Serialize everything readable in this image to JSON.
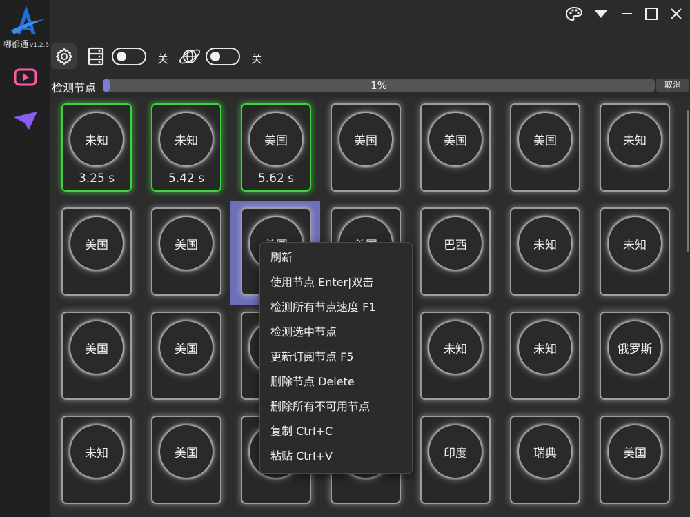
{
  "app": {
    "name": "哪都通",
    "version": "v1.2.5"
  },
  "toolbar": {
    "toggle1_label": "关",
    "toggle2_label": "关"
  },
  "progress": {
    "label": "检测节点",
    "value_text": "1%",
    "value": 0.01,
    "cancel_label": "取消"
  },
  "colors": {
    "accent": "#7b7fd4",
    "ok": "#3cd63c",
    "selection": "#6c6fb8"
  },
  "nodes": [
    {
      "name": "未知",
      "latency": "3.25 s",
      "ok": true
    },
    {
      "name": "未知",
      "latency": "5.42 s",
      "ok": true
    },
    {
      "name": "美国",
      "latency": "5.62 s",
      "ok": true
    },
    {
      "name": "美国"
    },
    {
      "name": "美国"
    },
    {
      "name": "美国"
    },
    {
      "name": "未知"
    },
    {
      "name": "美国"
    },
    {
      "name": "美国"
    },
    {
      "name": "美国",
      "selected": true
    },
    {
      "name": "美国"
    },
    {
      "name": "巴西"
    },
    {
      "name": "未知"
    },
    {
      "name": "未知"
    },
    {
      "name": "美国"
    },
    {
      "name": "美国"
    },
    {
      "name": ""
    },
    {
      "name": ""
    },
    {
      "name": "未知"
    },
    {
      "name": "未知"
    },
    {
      "name": "俄罗斯"
    },
    {
      "name": "未知"
    },
    {
      "name": "美国"
    },
    {
      "name": ""
    },
    {
      "name": ""
    },
    {
      "name": "印度"
    },
    {
      "name": "瑞典"
    },
    {
      "name": "美国"
    }
  ],
  "context_menu": [
    "刷新",
    "使用节点 Enter|双击",
    "检测所有节点速度 F1",
    "检测选中节点",
    "更新订阅节点 F5",
    "删除节点 Delete",
    "删除所有不可用节点",
    "复制 Ctrl+C",
    "粘贴 Ctrl+V"
  ]
}
